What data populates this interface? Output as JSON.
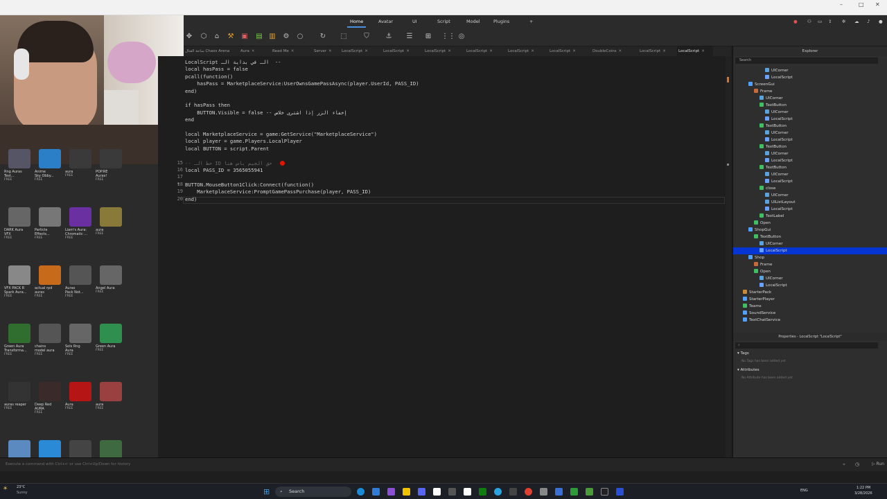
{
  "menu": {
    "tabs": [
      "Home",
      "Avatar",
      "UI",
      "Script",
      "Model",
      "Plugins"
    ],
    "active": "Home"
  },
  "editor_tabs": [
    {
      "label": "ساحة القتال Chaos Arena",
      "active": false
    },
    {
      "label": "Aura",
      "active": false
    },
    {
      "label": "Read Me",
      "active": false
    },
    {
      "label": "Server",
      "active": false
    },
    {
      "label": "LocalScript",
      "active": false
    },
    {
      "label": "LocalScript",
      "active": false
    },
    {
      "label": "LocalScript",
      "active": false
    },
    {
      "label": "LocalScript",
      "active": false
    },
    {
      "label": "LocalScript",
      "active": false
    },
    {
      "label": "LocalScript",
      "active": false
    },
    {
      "label": "DoubleCoins",
      "active": false
    },
    {
      "label": "LocalScript",
      "active": false
    },
    {
      "label": "LocalScript",
      "active": true
    }
  ],
  "code_lines": [
    {
      "n": "",
      "text": "LocalScript الـ في بداية الـ  --"
    },
    {
      "n": "",
      "text": "local hasPass = false"
    },
    {
      "n": "",
      "text": "pcall(function()"
    },
    {
      "n": "",
      "text": "    hasPass = MarketplaceService:UserOwnsGamePassAsync(player.UserId, PASS_ID)"
    },
    {
      "n": "",
      "text": "end)"
    },
    {
      "n": "",
      "text": ""
    },
    {
      "n": "",
      "text": "if hasPass then"
    },
    {
      "n": "",
      "text": "    BUTTON.Visible = false -- إخفاء الزر إذا اشترى خلاص"
    },
    {
      "n": "",
      "text": "end"
    },
    {
      "n": "",
      "text": ""
    },
    {
      "n": "",
      "text": "local MarketplaceService = game:GetService(\"MarketplaceService\")"
    },
    {
      "n": "",
      "text": "local player = game.Players.LocalPlayer"
    },
    {
      "n": "",
      "text": "local BUTTON = script.Parent"
    },
    {
      "n": "",
      "text": ""
    },
    {
      "n": "15",
      "text": "-- حط الـ ID حق الجيم باس هنا"
    },
    {
      "n": "16",
      "text": "local PASS_ID = 3565055941"
    },
    {
      "n": "17",
      "text": ""
    },
    {
      "n": "18",
      "text": "BUTTON.MouseButton1Click:Connect(function()"
    },
    {
      "n": "19",
      "text": "    MarketplaceService:PromptGamePassPurchase(player, PASS_ID)"
    },
    {
      "n": "20",
      "text": "end)"
    }
  ],
  "toolbox_items": [
    {
      "name": "Rng Auras\nTest...",
      "tag": "FREE",
      "color": "#556"
    },
    {
      "name": "Anime\nSky Obby...",
      "tag": "FREE",
      "color": "#2a7fc6"
    },
    {
      "name": "aura",
      "tag": "FREE",
      "color": "#3a3a3a"
    },
    {
      "name": "POP.RE\nAuras!",
      "tag": "FREE",
      "color": "#3a3a3a"
    },
    {
      "name": "DARK Aura\nVFX",
      "tag": "FREE",
      "color": "#666"
    },
    {
      "name": "Particle\nEffects...",
      "tag": "FREE",
      "color": "#777"
    },
    {
      "name": "Liam's Aura:\nChromatic ...",
      "tag": "FREE",
      "color": "#6a2fa0"
    },
    {
      "name": "aura",
      "tag": "FREE",
      "color": "#8a7a3a"
    },
    {
      "name": "VFX PACK R\nSpark Aura...",
      "tag": "FREE",
      "color": "#888"
    },
    {
      "name": "actual rpd\nauras",
      "tag": "FREE",
      "color": "#c76a1a"
    },
    {
      "name": "Auras\nPack Not...",
      "tag": "FREE",
      "color": "#555"
    },
    {
      "name": "Angel Aura",
      "tag": "FREE",
      "color": "#666"
    },
    {
      "name": "Green Aura\nTransforma...",
      "tag": "FREE",
      "color": "#2f6e2f"
    },
    {
      "name": "chains\nmodel aura",
      "tag": "FREE",
      "color": "#555"
    },
    {
      "name": "Sols Rng\nAura",
      "tag": "FREE",
      "color": "#666"
    },
    {
      "name": "Green Aura",
      "tag": "FREE",
      "color": "#2f8f4f"
    },
    {
      "name": "auras reaper",
      "tag": "FREE",
      "color": "#333"
    },
    {
      "name": "Deep Red\nAURA",
      "tag": "FREE",
      "color": "#3a2a2a"
    },
    {
      "name": "Aura",
      "tag": "FREE",
      "color": "#b51515"
    },
    {
      "name": "aura",
      "tag": "FREE",
      "color": "#9a4040"
    },
    {
      "name": "",
      "tag": "",
      "color": "#5a8ac0"
    },
    {
      "name": "",
      "tag": "",
      "color": "#2a8ad6"
    },
    {
      "name": "",
      "tag": "",
      "color": "#444"
    },
    {
      "name": "",
      "tag": "",
      "color": "#3f6a3f"
    }
  ],
  "explorer": {
    "title": "Explorer",
    "search_placeholder": "Search",
    "rows": [
      {
        "indent": 5,
        "label": "UICorner",
        "icon": "#5ba3e0",
        "sel": false
      },
      {
        "indent": 5,
        "label": "LocalScript",
        "icon": "#6aa3ff",
        "sel": false
      },
      {
        "indent": 2,
        "label": "ScreenGui",
        "icon": "#4fa3ff",
        "sel": false
      },
      {
        "indent": 3,
        "label": "Frame",
        "icon": "#c86a3a",
        "sel": false
      },
      {
        "indent": 4,
        "label": "UICorner",
        "icon": "#5ba3e0",
        "sel": false
      },
      {
        "indent": 4,
        "label": "TextButton",
        "icon": "#3fbf5f",
        "sel": false
      },
      {
        "indent": 5,
        "label": "UICorner",
        "icon": "#5ba3e0",
        "sel": false
      },
      {
        "indent": 5,
        "label": "LocalScript",
        "icon": "#6aa3ff",
        "sel": false
      },
      {
        "indent": 4,
        "label": "TextButton",
        "icon": "#3fbf5f",
        "sel": false
      },
      {
        "indent": 5,
        "label": "UICorner",
        "icon": "#5ba3e0",
        "sel": false
      },
      {
        "indent": 5,
        "label": "LocalScript",
        "icon": "#6aa3ff",
        "sel": false
      },
      {
        "indent": 4,
        "label": "TextButton",
        "icon": "#3fbf5f",
        "sel": false
      },
      {
        "indent": 5,
        "label": "UICorner",
        "icon": "#5ba3e0",
        "sel": false
      },
      {
        "indent": 5,
        "label": "LocalScript",
        "icon": "#6aa3ff",
        "sel": false
      },
      {
        "indent": 4,
        "label": "TextButton",
        "icon": "#3fbf5f",
        "sel": false
      },
      {
        "indent": 5,
        "label": "UICorner",
        "icon": "#5ba3e0",
        "sel": false
      },
      {
        "indent": 5,
        "label": "LocalScript",
        "icon": "#6aa3ff",
        "sel": false
      },
      {
        "indent": 4,
        "label": "close",
        "icon": "#3fbf5f",
        "sel": false
      },
      {
        "indent": 5,
        "label": "UICorner",
        "icon": "#5ba3e0",
        "sel": false
      },
      {
        "indent": 5,
        "label": "UIListLayout",
        "icon": "#5ba3e0",
        "sel": false
      },
      {
        "indent": 5,
        "label": "LocalScript",
        "icon": "#6aa3ff",
        "sel": false
      },
      {
        "indent": 4,
        "label": "TextLabel",
        "icon": "#3fbf5f",
        "sel": false
      },
      {
        "indent": 3,
        "label": "Open",
        "icon": "#3fbf5f",
        "sel": false
      },
      {
        "indent": 2,
        "label": "ShopGui",
        "icon": "#4fa3ff",
        "sel": false
      },
      {
        "indent": 3,
        "label": "TextButton",
        "icon": "#3fbf5f",
        "sel": false
      },
      {
        "indent": 4,
        "label": "UICorner",
        "icon": "#5ba3e0",
        "sel": false
      },
      {
        "indent": 4,
        "label": "LocalScript",
        "icon": "#6aa3ff",
        "sel": true
      },
      {
        "indent": 2,
        "label": "Shop",
        "icon": "#4fa3ff",
        "sel": false
      },
      {
        "indent": 3,
        "label": "Frame",
        "icon": "#c86a3a",
        "sel": false
      },
      {
        "indent": 3,
        "label": "Open",
        "icon": "#3fbf5f",
        "sel": false
      },
      {
        "indent": 4,
        "label": "UICorner",
        "icon": "#5ba3e0",
        "sel": false
      },
      {
        "indent": 4,
        "label": "LocalScript",
        "icon": "#6aa3ff",
        "sel": false
      },
      {
        "indent": 1,
        "label": "StarterPack",
        "icon": "#c98a3a",
        "sel": false
      },
      {
        "indent": 1,
        "label": "StarterPlayer",
        "icon": "#4fa3ff",
        "sel": false
      },
      {
        "indent": 1,
        "label": "Teams",
        "icon": "#3fbf5f",
        "sel": false
      },
      {
        "indent": 1,
        "label": "SoundService",
        "icon": "#4fa3ff",
        "sel": false
      },
      {
        "indent": 1,
        "label": "TextChatService",
        "icon": "#4fa3ff",
        "sel": false
      }
    ]
  },
  "properties": {
    "title": "Properties - LocalScript \"LocalScript\"",
    "tags_label": "Tags",
    "tags_note": "No Tags has been added yet",
    "attrs_label": "Attributes",
    "attrs_note": "No Attribute has been added yet"
  },
  "command_bar": {
    "placeholder": "Execute a command with Ctrl+↵ or use Ctrl+Up/Down for history"
  },
  "taskbar": {
    "weather_temp": "23°C",
    "weather_desc": "Sunny",
    "search_label": "Search",
    "lang": "ENG",
    "time": "1:22 PM",
    "date": "3/28/2026"
  },
  "colors": {
    "accent": "#0535d2",
    "editor_bg": "#1e1e1e",
    "breakpoint": "#e51400"
  }
}
